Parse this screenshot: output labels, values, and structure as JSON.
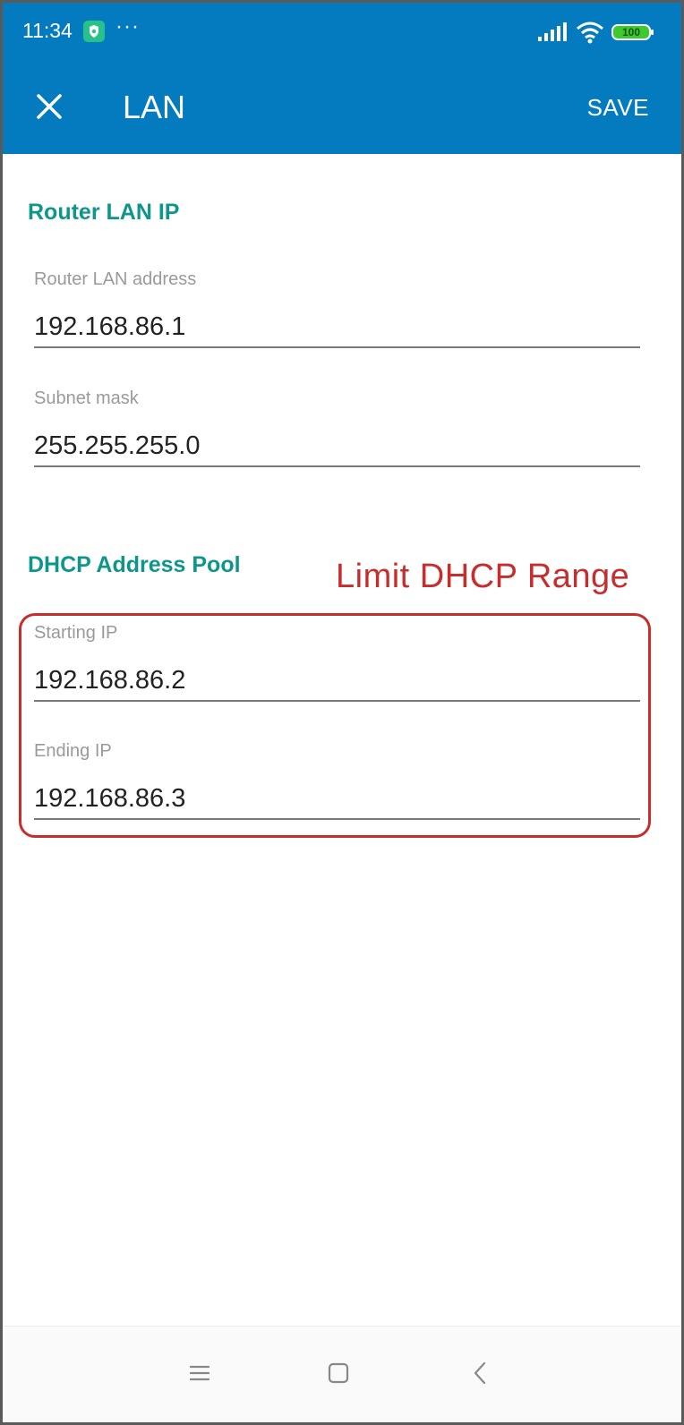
{
  "status_bar": {
    "time": "11:34",
    "more": "···",
    "battery_level": "100"
  },
  "header": {
    "title": "LAN",
    "save_label": "SAVE",
    "close_icon": "close-icon",
    "background": "#047bbf"
  },
  "sections": {
    "router": {
      "title": "Router LAN IP",
      "fields": [
        {
          "label": "Router LAN address",
          "value": "192.168.86.1"
        },
        {
          "label": "Subnet mask",
          "value": "255.255.255.0"
        }
      ]
    },
    "dhcp": {
      "title": "DHCP Address Pool",
      "fields": [
        {
          "label": "Starting IP",
          "value": "192.168.86.2"
        },
        {
          "label": "Ending IP",
          "value": "192.168.86.3"
        }
      ]
    }
  },
  "annotation": {
    "label": "Limit DHCP Range",
    "color": "#c62d2c"
  },
  "nav_bar": {
    "icons": [
      "menu-icon",
      "home-icon",
      "back-icon"
    ]
  },
  "colors": {
    "accent": "#0e968a",
    "appbar": "#047bbf"
  }
}
